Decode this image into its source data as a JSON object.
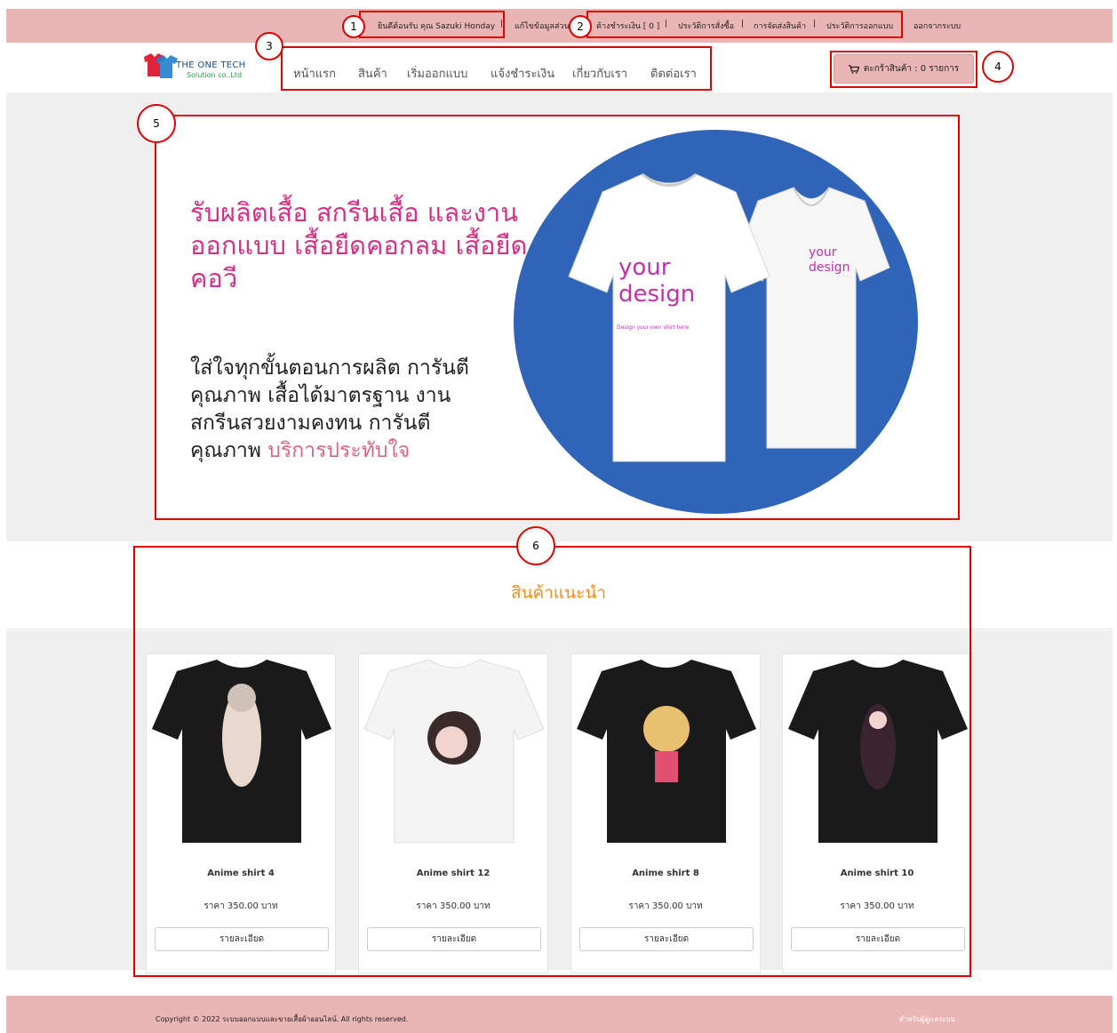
{
  "topbar": {
    "welcome": "ยินดีต้อนรับ คุณ Sazuki Honday",
    "edit_profile": "แก้ไขข้อมูลส่วนตัว",
    "pending_payment": "ค้างชำระเงิน [ 0 ]",
    "order_history": "ประวัติการสั่งซื้อ",
    "shipping": "การจัดส่งสินค้า",
    "design_history": "ประวัติการออกแบบ",
    "logout": "ออกจากระบบ",
    "separator": "|"
  },
  "logo": {
    "brand": "THE ONE TECH",
    "sub": "Solution co.,Ltd"
  },
  "nav": {
    "items": [
      "หน้าแรก",
      "สินค้า",
      "เริ่มออกแบบ",
      "แจ้งชำระเงิน",
      "เกี่ยวกับเรา",
      "ติดต่อเรา"
    ]
  },
  "cart": {
    "label": "ตะกร้าสินค้า : 0 รายการ"
  },
  "hero": {
    "headline": "รับผลิตเสื้อ สกรีนเสื้อ และงานออกแบบ เสื้อยืดคอกลม เสื้อยืดคอวี",
    "body": "ใส่ใจทุกขั้นตอนการผลิต การันตีคุณภาพ เสื้อได้มาตรฐาน งานสกรีนสวยงามคงทน การันตีคุณภาพ",
    "body_highlight": "บริการประทับใจ",
    "shirt_front_text": "your design",
    "shirt_front_small": "Design your own shirt here",
    "shirt_back_text": "your design"
  },
  "recommended": {
    "title": "สินค้าแนะนำ",
    "products": [
      {
        "name": "Anime shirt 4",
        "price": "ราคา 350.00 บาท",
        "button": "รายละเอียด",
        "shirt_color": "#1a1a1a"
      },
      {
        "name": "Anime shirt 12",
        "price": "ราคา 350.00 บาท",
        "button": "รายละเอียด",
        "shirt_color": "#f4f4f4"
      },
      {
        "name": "Anime shirt 8",
        "price": "ราคา 350.00 บาท",
        "button": "รายละเอียด",
        "shirt_color": "#1a1a1a"
      },
      {
        "name": "Anime shirt 10",
        "price": "ราคา 350.00 บาท",
        "button": "รายละเอียด",
        "shirt_color": "#1a1a1a"
      }
    ]
  },
  "footer": {
    "copyright": "Copyright © 2022 ระบบออกแบบและขายเสื้อผ้าออนไลน์. All rights reserved.",
    "admin_link": "สำหรับผู้ดูแลระบบ"
  },
  "annotations": [
    "1",
    "2",
    "3",
    "4",
    "5",
    "6"
  ],
  "colors": {
    "accent_pink": "#e9b5b5",
    "headline_pink": "#d62f86",
    "title_orange": "#f08c1a",
    "circle_blue": "#2f64b8",
    "annotation_red": "#e00000"
  }
}
